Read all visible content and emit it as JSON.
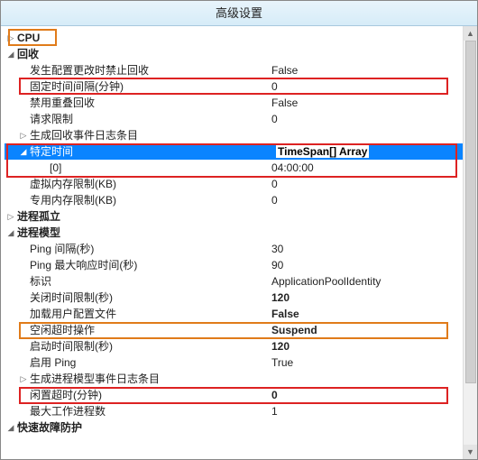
{
  "window": {
    "title": "高级设置"
  },
  "icons": {
    "collapsed": "▷",
    "expanded": "◢",
    "up": "▲",
    "down": "▼"
  },
  "rows": {
    "cpu": "CPU",
    "recycle": "回收",
    "r1_label": "发生配置更改时禁止回收",
    "r1_value": "False",
    "r2_label": "固定时间间隔(分钟)",
    "r2_value": "0",
    "r3_label": "禁用重叠回收",
    "r3_value": "False",
    "r4_label": "请求限制",
    "r4_value": "0",
    "r5_label": "生成回收事件日志条目",
    "specific_time_label": "特定时间",
    "specific_time_value": "TimeSpan[] Array",
    "st0_label": "[0]",
    "st0_value": "04:00:00",
    "r8_label": "虚拟内存限制(KB)",
    "r8_value": "0",
    "r9_label": "专用内存限制(KB)",
    "r9_value": "0",
    "proc_isolation": "进程孤立",
    "proc_model": "进程模型",
    "p1_label": "Ping 间隔(秒)",
    "p1_value": "30",
    "p2_label": "Ping 最大响应时间(秒)",
    "p2_value": "90",
    "p3_label": "标识",
    "p3_value": "ApplicationPoolIdentity",
    "p4_label": "关闭时间限制(秒)",
    "p4_value": "120",
    "p5_label": "加载用户配置文件",
    "p5_value": "False",
    "p6_label": "空闲超时操作",
    "p6_value": "Suspend",
    "p7_label": "启动时间限制(秒)",
    "p7_value": "120",
    "p8_label": "启用 Ping",
    "p8_value": "True",
    "p9_label": "生成进程模型事件日志条目",
    "idle_label": "闲置超时(分钟)",
    "idle_value": "0",
    "p11_label": "最大工作进程数",
    "p11_value": "1",
    "rapid_fail": "快速故障防护"
  }
}
